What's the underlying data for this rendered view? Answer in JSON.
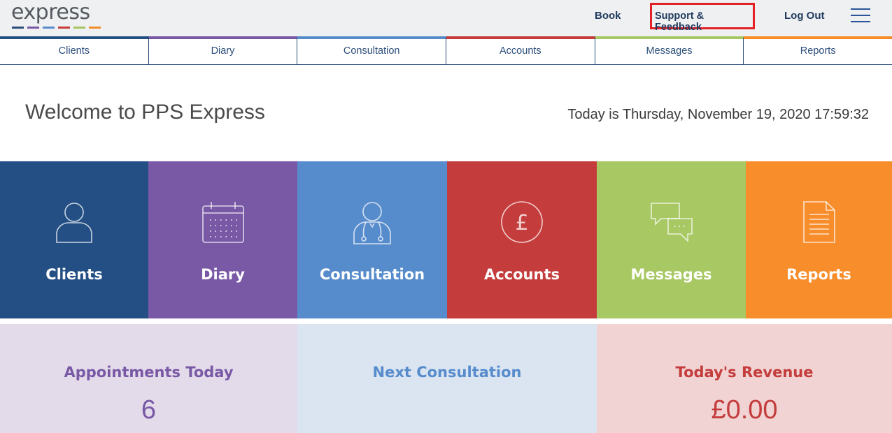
{
  "header": {
    "logo_text": "express",
    "logo_colors": [
      "#2a4d7a",
      "#7a5aa6",
      "#5b8ccd",
      "#c63d3d",
      "#a6c562",
      "#f28e2b"
    ],
    "links": {
      "book": "Book",
      "support": "Support & Feedback",
      "logout": "Log Out"
    },
    "menu_icon": "hamburger-icon"
  },
  "nav": {
    "tabs": [
      {
        "label": "Clients",
        "color": "#234e83"
      },
      {
        "label": "Diary",
        "color": "#7a58a4"
      },
      {
        "label": "Consultation",
        "color": "#568bcb"
      },
      {
        "label": "Accounts",
        "color": "#c33c3b"
      },
      {
        "label": "Messages",
        "color": "#a6c762"
      },
      {
        "label": "Reports",
        "color": "#f78c2a"
      }
    ]
  },
  "welcome": {
    "title": "Welcome to PPS Express",
    "today": "Today is Thursday, November 19, 2020 17:59:32"
  },
  "tiles": [
    {
      "label": "Clients",
      "icon": "user-icon",
      "color": "#244f84"
    },
    {
      "label": "Diary",
      "icon": "calendar-icon",
      "color": "#7958a5"
    },
    {
      "label": "Consultation",
      "icon": "doctor-icon",
      "color": "#578ccc"
    },
    {
      "label": "Accounts",
      "icon": "pound-coin-icon",
      "color": "#c43c3c"
    },
    {
      "label": "Messages",
      "icon": "chat-bubbles-icon",
      "color": "#a7c863"
    },
    {
      "label": "Reports",
      "icon": "document-icon",
      "color": "#f88d2b"
    }
  ],
  "stats": {
    "appointments": {
      "title": "Appointments Today",
      "value": "6",
      "bg": "#e3dbea",
      "color": "#7958a5"
    },
    "next_consultation": {
      "title": "Next Consultation",
      "value": "",
      "bg": "#dbe5f2",
      "color": "#578ccc"
    },
    "revenue": {
      "title": "Today's Revenue",
      "value": "£0.00",
      "bg": "#f1d3d3",
      "color": "#c43c3c"
    }
  }
}
